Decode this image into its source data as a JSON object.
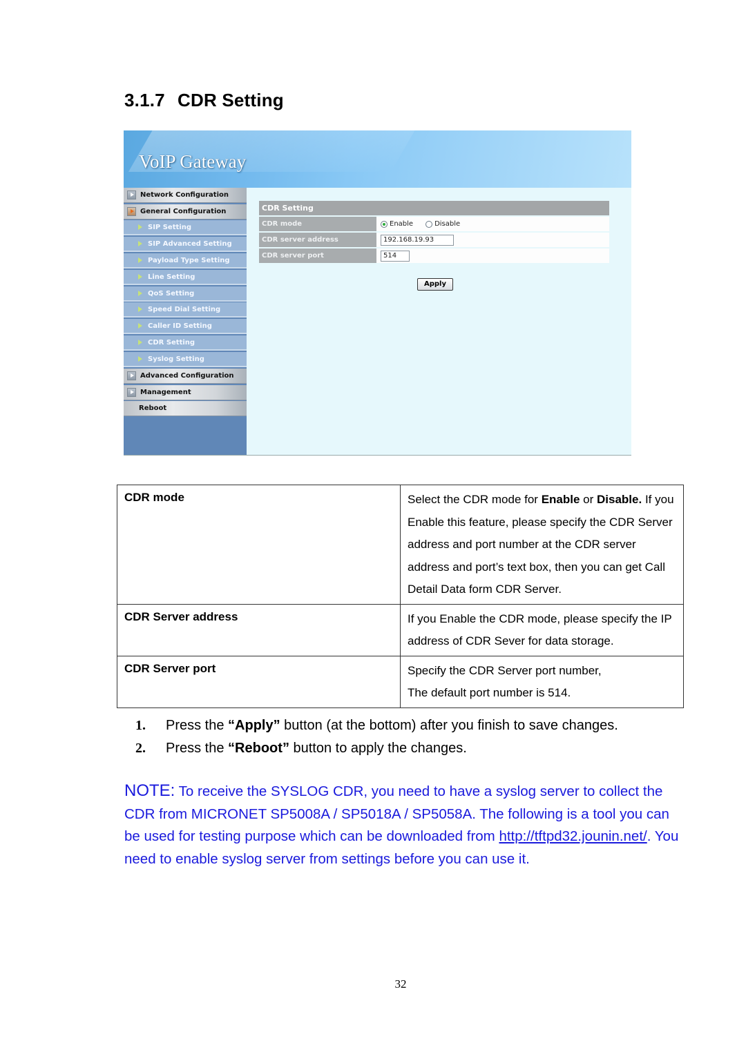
{
  "section": {
    "number": "3.1.7",
    "title": "CDR Setting"
  },
  "screenshot": {
    "banner_title": "VoIP Gateway",
    "sidebar": {
      "items": [
        {
          "label": "Network Configuration",
          "level": "top",
          "icon": "expand-arrow-icon"
        },
        {
          "label": "General Configuration",
          "level": "top",
          "icon": "expanded-arrow-icon",
          "expanded": true
        },
        {
          "label": "SIP Setting",
          "level": "sub",
          "icon": "triangle-bullet-icon"
        },
        {
          "label": "SIP Advanced Setting",
          "level": "sub",
          "icon": "triangle-bullet-icon"
        },
        {
          "label": "Payload Type Setting",
          "level": "sub",
          "icon": "triangle-bullet-icon"
        },
        {
          "label": "Line Setting",
          "level": "sub",
          "icon": "triangle-bullet-icon"
        },
        {
          "label": "QoS Setting",
          "level": "sub",
          "icon": "triangle-bullet-icon"
        },
        {
          "label": "Speed Dial Setting",
          "level": "sub",
          "icon": "triangle-bullet-icon"
        },
        {
          "label": "Caller ID Setting",
          "level": "sub",
          "icon": "triangle-bullet-icon"
        },
        {
          "label": "CDR Setting",
          "level": "sub",
          "icon": "triangle-bullet-icon",
          "active": true
        },
        {
          "label": "Syslog Setting",
          "level": "sub",
          "icon": "triangle-bullet-icon"
        },
        {
          "label": "Advanced Configuration",
          "level": "top",
          "icon": "expand-arrow-icon"
        },
        {
          "label": "Management",
          "level": "top",
          "icon": "expand-arrow-icon"
        },
        {
          "label": "Reboot",
          "level": "plain"
        }
      ]
    },
    "form": {
      "heading": "CDR Setting",
      "cdr_mode_label": "CDR mode",
      "cdr_mode_options": [
        "Enable",
        "Disable"
      ],
      "cdr_mode_selected": "Enable",
      "server_address_label": "CDR server address",
      "server_address_value": "192.168.19.93",
      "server_port_label": "CDR server port",
      "server_port_value": "514",
      "apply_label": "Apply"
    }
  },
  "table": {
    "rows": [
      {
        "key": "CDR mode",
        "value_prefix": "Select the CDR mode for ",
        "bold1": "Enable",
        "mid": " or ",
        "bold2": "Disable.",
        "value_suffix": " If you Enable this feature, please specify the CDR Server address and port number at the CDR server address and port’s text box, then you can get Call Detail Data form CDR Server."
      },
      {
        "key": "CDR Server address",
        "value": "If you Enable the CDR mode, please specify the IP address of CDR Sever for data storage."
      },
      {
        "key": "CDR Server port",
        "value_line1": "Specify the CDR Server port number,",
        "value_line2": "The default port number is 514."
      }
    ]
  },
  "steps": [
    {
      "n": "1.",
      "pre": "Press the ",
      "q1": "“",
      "bold": "Apply",
      "q2": "”",
      "post": " button (at the bottom) after you finish to save changes."
    },
    {
      "n": "2.",
      "pre": "Press the ",
      "q1": "“",
      "bold": "Reboot",
      "q2": "”",
      "post": " button to apply the changes."
    }
  ],
  "note": {
    "tag": "NOTE:",
    "text1": " To receive the SYSLOG CDR, you need to have a syslog server to collect the CDR from MICRONET SP5008A / SP5018A / SP5058A. The following is a tool you can be used for testing purpose which can be downloaded from ",
    "link": "http://tftpd32.jounin.net/",
    "text2": ". You need to enable syslog server from settings before you can use it."
  },
  "page_number": "32",
  "colors": {
    "note_blue": "#1a1adc",
    "sidebar_blue": "#6087b7",
    "sub_item_blue": "#9ab7d8",
    "form_label_gray": "#a8acae",
    "content_bg": "#e6f8fc"
  }
}
